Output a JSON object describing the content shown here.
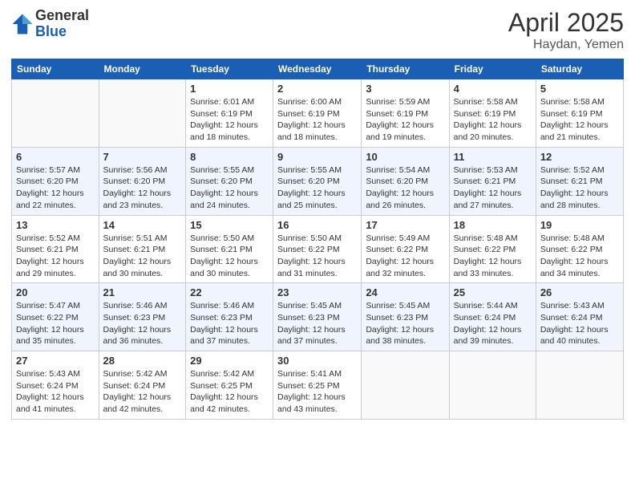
{
  "logo": {
    "general": "General",
    "blue": "Blue"
  },
  "title": {
    "month_year": "April 2025",
    "location": "Haydan, Yemen"
  },
  "weekdays": [
    "Sunday",
    "Monday",
    "Tuesday",
    "Wednesday",
    "Thursday",
    "Friday",
    "Saturday"
  ],
  "weeks": [
    [
      {
        "day": null,
        "sunrise": null,
        "sunset": null,
        "daylight": null
      },
      {
        "day": null,
        "sunrise": null,
        "sunset": null,
        "daylight": null
      },
      {
        "day": "1",
        "sunrise": "Sunrise: 6:01 AM",
        "sunset": "Sunset: 6:19 PM",
        "daylight": "Daylight: 12 hours and 18 minutes."
      },
      {
        "day": "2",
        "sunrise": "Sunrise: 6:00 AM",
        "sunset": "Sunset: 6:19 PM",
        "daylight": "Daylight: 12 hours and 18 minutes."
      },
      {
        "day": "3",
        "sunrise": "Sunrise: 5:59 AM",
        "sunset": "Sunset: 6:19 PM",
        "daylight": "Daylight: 12 hours and 19 minutes."
      },
      {
        "day": "4",
        "sunrise": "Sunrise: 5:58 AM",
        "sunset": "Sunset: 6:19 PM",
        "daylight": "Daylight: 12 hours and 20 minutes."
      },
      {
        "day": "5",
        "sunrise": "Sunrise: 5:58 AM",
        "sunset": "Sunset: 6:19 PM",
        "daylight": "Daylight: 12 hours and 21 minutes."
      }
    ],
    [
      {
        "day": "6",
        "sunrise": "Sunrise: 5:57 AM",
        "sunset": "Sunset: 6:20 PM",
        "daylight": "Daylight: 12 hours and 22 minutes."
      },
      {
        "day": "7",
        "sunrise": "Sunrise: 5:56 AM",
        "sunset": "Sunset: 6:20 PM",
        "daylight": "Daylight: 12 hours and 23 minutes."
      },
      {
        "day": "8",
        "sunrise": "Sunrise: 5:55 AM",
        "sunset": "Sunset: 6:20 PM",
        "daylight": "Daylight: 12 hours and 24 minutes."
      },
      {
        "day": "9",
        "sunrise": "Sunrise: 5:55 AM",
        "sunset": "Sunset: 6:20 PM",
        "daylight": "Daylight: 12 hours and 25 minutes."
      },
      {
        "day": "10",
        "sunrise": "Sunrise: 5:54 AM",
        "sunset": "Sunset: 6:20 PM",
        "daylight": "Daylight: 12 hours and 26 minutes."
      },
      {
        "day": "11",
        "sunrise": "Sunrise: 5:53 AM",
        "sunset": "Sunset: 6:21 PM",
        "daylight": "Daylight: 12 hours and 27 minutes."
      },
      {
        "day": "12",
        "sunrise": "Sunrise: 5:52 AM",
        "sunset": "Sunset: 6:21 PM",
        "daylight": "Daylight: 12 hours and 28 minutes."
      }
    ],
    [
      {
        "day": "13",
        "sunrise": "Sunrise: 5:52 AM",
        "sunset": "Sunset: 6:21 PM",
        "daylight": "Daylight: 12 hours and 29 minutes."
      },
      {
        "day": "14",
        "sunrise": "Sunrise: 5:51 AM",
        "sunset": "Sunset: 6:21 PM",
        "daylight": "Daylight: 12 hours and 30 minutes."
      },
      {
        "day": "15",
        "sunrise": "Sunrise: 5:50 AM",
        "sunset": "Sunset: 6:21 PM",
        "daylight": "Daylight: 12 hours and 30 minutes."
      },
      {
        "day": "16",
        "sunrise": "Sunrise: 5:50 AM",
        "sunset": "Sunset: 6:22 PM",
        "daylight": "Daylight: 12 hours and 31 minutes."
      },
      {
        "day": "17",
        "sunrise": "Sunrise: 5:49 AM",
        "sunset": "Sunset: 6:22 PM",
        "daylight": "Daylight: 12 hours and 32 minutes."
      },
      {
        "day": "18",
        "sunrise": "Sunrise: 5:48 AM",
        "sunset": "Sunset: 6:22 PM",
        "daylight": "Daylight: 12 hours and 33 minutes."
      },
      {
        "day": "19",
        "sunrise": "Sunrise: 5:48 AM",
        "sunset": "Sunset: 6:22 PM",
        "daylight": "Daylight: 12 hours and 34 minutes."
      }
    ],
    [
      {
        "day": "20",
        "sunrise": "Sunrise: 5:47 AM",
        "sunset": "Sunset: 6:22 PM",
        "daylight": "Daylight: 12 hours and 35 minutes."
      },
      {
        "day": "21",
        "sunrise": "Sunrise: 5:46 AM",
        "sunset": "Sunset: 6:23 PM",
        "daylight": "Daylight: 12 hours and 36 minutes."
      },
      {
        "day": "22",
        "sunrise": "Sunrise: 5:46 AM",
        "sunset": "Sunset: 6:23 PM",
        "daylight": "Daylight: 12 hours and 37 minutes."
      },
      {
        "day": "23",
        "sunrise": "Sunrise: 5:45 AM",
        "sunset": "Sunset: 6:23 PM",
        "daylight": "Daylight: 12 hours and 37 minutes."
      },
      {
        "day": "24",
        "sunrise": "Sunrise: 5:45 AM",
        "sunset": "Sunset: 6:23 PM",
        "daylight": "Daylight: 12 hours and 38 minutes."
      },
      {
        "day": "25",
        "sunrise": "Sunrise: 5:44 AM",
        "sunset": "Sunset: 6:24 PM",
        "daylight": "Daylight: 12 hours and 39 minutes."
      },
      {
        "day": "26",
        "sunrise": "Sunrise: 5:43 AM",
        "sunset": "Sunset: 6:24 PM",
        "daylight": "Daylight: 12 hours and 40 minutes."
      }
    ],
    [
      {
        "day": "27",
        "sunrise": "Sunrise: 5:43 AM",
        "sunset": "Sunset: 6:24 PM",
        "daylight": "Daylight: 12 hours and 41 minutes."
      },
      {
        "day": "28",
        "sunrise": "Sunrise: 5:42 AM",
        "sunset": "Sunset: 6:24 PM",
        "daylight": "Daylight: 12 hours and 42 minutes."
      },
      {
        "day": "29",
        "sunrise": "Sunrise: 5:42 AM",
        "sunset": "Sunset: 6:25 PM",
        "daylight": "Daylight: 12 hours and 42 minutes."
      },
      {
        "day": "30",
        "sunrise": "Sunrise: 5:41 AM",
        "sunset": "Sunset: 6:25 PM",
        "daylight": "Daylight: 12 hours and 43 minutes."
      },
      {
        "day": null,
        "sunrise": null,
        "sunset": null,
        "daylight": null
      },
      {
        "day": null,
        "sunrise": null,
        "sunset": null,
        "daylight": null
      },
      {
        "day": null,
        "sunrise": null,
        "sunset": null,
        "daylight": null
      }
    ]
  ]
}
